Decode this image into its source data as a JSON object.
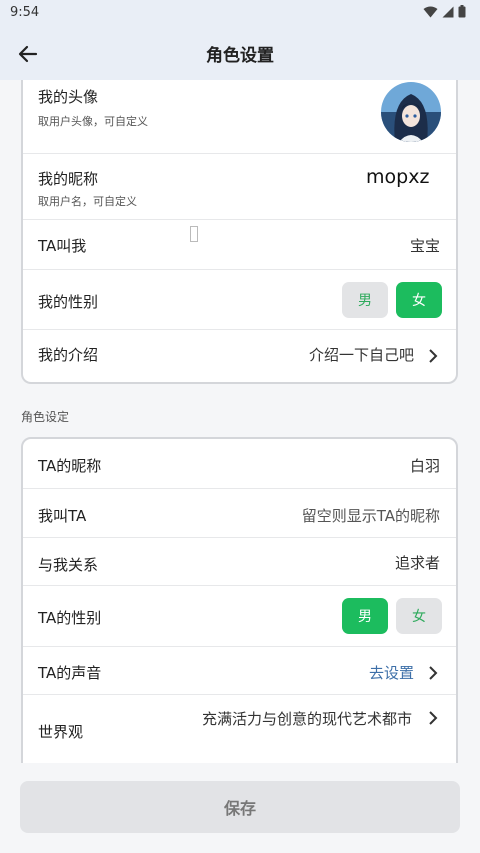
{
  "status": {
    "time": "9:54"
  },
  "header": {
    "title": "角色设置"
  },
  "profile": {
    "avatar": {
      "label": "我的头像",
      "sub": "取用户头像，可自定义"
    },
    "nickname": {
      "label": "我的昵称",
      "sub": "取用户名，可自定义",
      "value": "mopxz"
    },
    "ta_calls_me": {
      "label": "TA叫我",
      "value": "宝宝"
    },
    "gender": {
      "label": "我的性别",
      "male": "男",
      "female": "女",
      "selected": "女"
    },
    "intro": {
      "label": "我的介绍",
      "value": "介绍一下自己吧"
    }
  },
  "role_section": {
    "heading": "角色设定",
    "ta_nickname": {
      "label": "TA的昵称",
      "value": "白羽"
    },
    "i_call_ta": {
      "label": "我叫TA",
      "placeholder": "留空则显示TA的昵称"
    },
    "relation": {
      "label": "与我关系",
      "value": "追求者"
    },
    "ta_gender": {
      "label": "TA的性别",
      "male": "男",
      "female": "女",
      "selected": "男"
    },
    "ta_voice": {
      "label": "TA的声音",
      "value": "去设置"
    },
    "world": {
      "label": "世界观",
      "value": "充满活力与创意的现代艺术都市"
    }
  },
  "footer": {
    "save_label": "保存"
  },
  "colors": {
    "accent": "#1cbc5e",
    "link": "#3d6fa8",
    "header_bg": "#e9eef6"
  }
}
